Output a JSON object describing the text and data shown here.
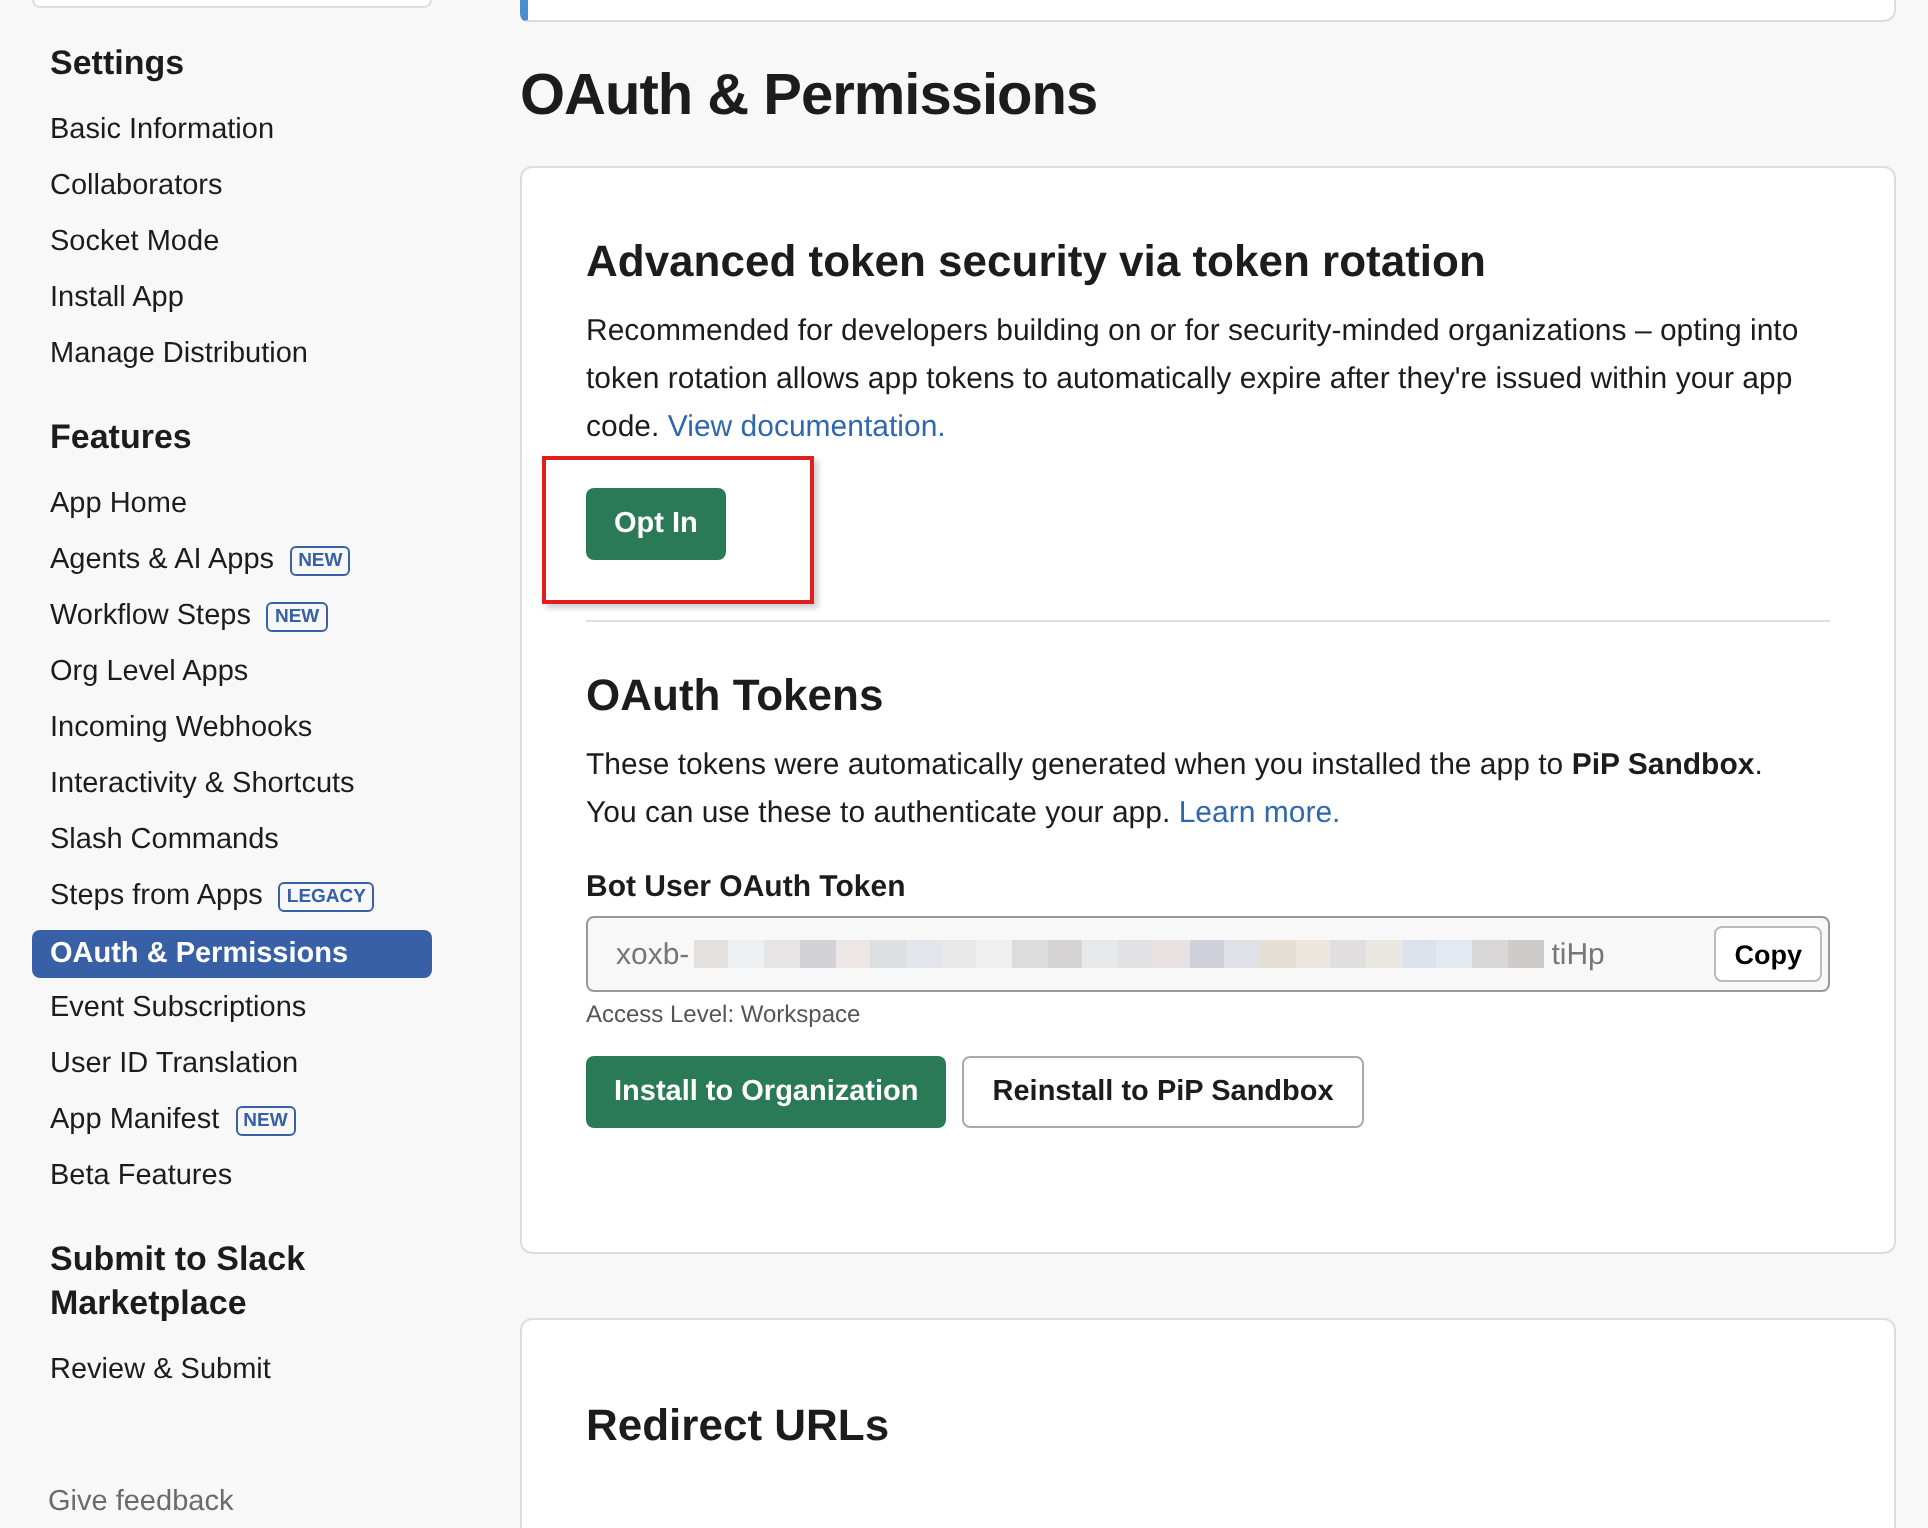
{
  "sidebar": {
    "sections": [
      {
        "title": "Settings",
        "items": [
          {
            "label": "Basic Information",
            "selected": false
          },
          {
            "label": "Collaborators",
            "selected": false
          },
          {
            "label": "Socket Mode",
            "selected": false
          },
          {
            "label": "Install App",
            "selected": false
          },
          {
            "label": "Manage Distribution",
            "selected": false
          }
        ]
      },
      {
        "title": "Features",
        "items": [
          {
            "label": "App Home",
            "selected": false
          },
          {
            "label": "Agents & AI Apps",
            "badge": "NEW",
            "selected": false
          },
          {
            "label": "Workflow Steps",
            "badge": "NEW",
            "selected": false
          },
          {
            "label": "Org Level Apps",
            "selected": false
          },
          {
            "label": "Incoming Webhooks",
            "selected": false
          },
          {
            "label": "Interactivity & Shortcuts",
            "selected": false
          },
          {
            "label": "Slash Commands",
            "selected": false
          },
          {
            "label": "Steps from Apps",
            "badge": "LEGACY",
            "selected": false
          },
          {
            "label": "OAuth & Permissions",
            "selected": true
          },
          {
            "label": "Event Subscriptions",
            "selected": false
          },
          {
            "label": "User ID Translation",
            "selected": false
          },
          {
            "label": "App Manifest",
            "badge": "NEW",
            "selected": false
          },
          {
            "label": "Beta Features",
            "selected": false
          }
        ]
      },
      {
        "title": "Submit to Slack Marketplace",
        "items": [
          {
            "label": "Review & Submit",
            "selected": false
          }
        ]
      }
    ],
    "feedback": "Give feedback"
  },
  "page_title": "OAuth & Permissions",
  "token_rotation": {
    "title": "Advanced token security via token rotation",
    "text": "Recommended for developers building on or for security-minded organizations – opting into token rotation allows app tokens to automatically expire after they're issued within your app code.",
    "link": "View documentation.",
    "button": "Opt In",
    "highlighted": true
  },
  "oauth_tokens": {
    "title": "OAuth Tokens",
    "text": "These tokens were automatically generated when you installed the app to **PiP Sandbox**.",
    "text2": "You can use these to authenticate your app.",
    "link": "Learn more.",
    "token_label": "Bot User OAuth Token",
    "token_prefix": "xoxb-",
    "token_suffix": "tiHp",
    "copy_button": "Copy",
    "access_level": "Access Level: Workspace",
    "buttons": [
      {
        "label": "Install to Organization",
        "kind": "primary"
      },
      {
        "label": "Reinstall to PiP Sandbox",
        "kind": "secondary"
      }
    ]
  },
  "redirect_urls": {
    "title": "Redirect URLs"
  }
}
